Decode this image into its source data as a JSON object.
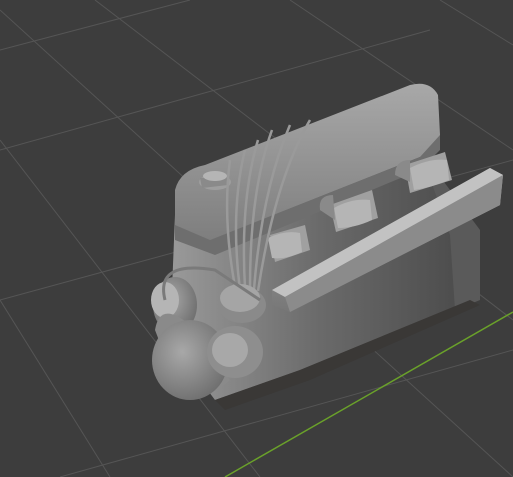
{
  "viewport": {
    "kind": "3d-viewport",
    "background_color": "#3d3d3d",
    "grid_color": "#555555",
    "x_axis_color": "#6aa12a",
    "object": {
      "description_icon": "engine-mesh-icon",
      "base_color": "#8c8c8c",
      "shadow_color": "#555555",
      "highlight_color": "#b5b5b5"
    }
  }
}
